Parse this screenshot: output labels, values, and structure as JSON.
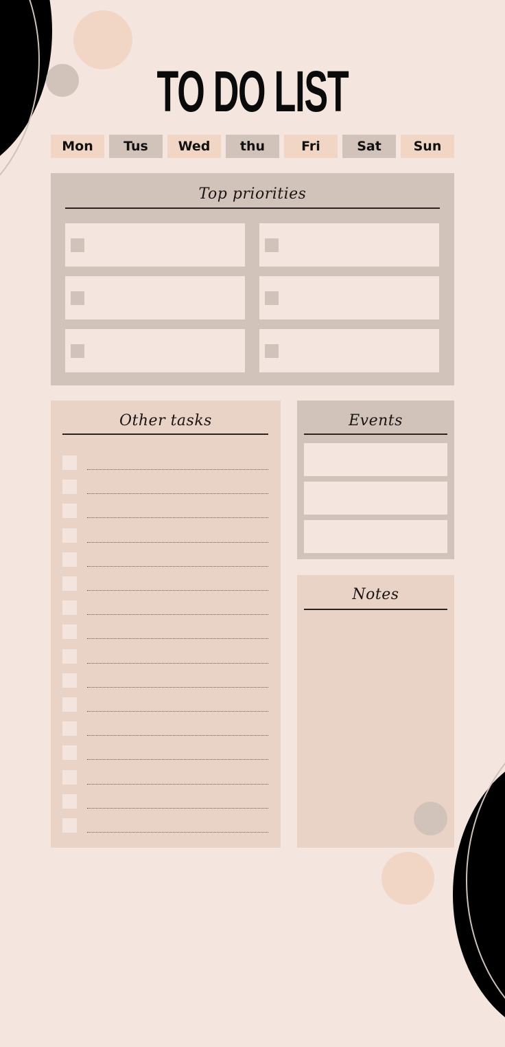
{
  "title": "TO DO LIST",
  "days": [
    "Mon",
    "Tus",
    "Wed",
    "thu",
    "Fri",
    "Sat",
    "Sun"
  ],
  "top_priorities": {
    "heading": "Top priorities",
    "items": [
      {
        "checked": false,
        "text": ""
      },
      {
        "checked": false,
        "text": ""
      },
      {
        "checked": false,
        "text": ""
      },
      {
        "checked": false,
        "text": ""
      },
      {
        "checked": false,
        "text": ""
      },
      {
        "checked": false,
        "text": ""
      }
    ]
  },
  "other_tasks": {
    "heading": "Other tasks",
    "item_count": 16
  },
  "events": {
    "heading": "Events",
    "slots": [
      "",
      "",
      ""
    ]
  },
  "notes": {
    "heading": "Notes",
    "text": ""
  },
  "colors": {
    "background": "#f4e6df",
    "peach": "#f1d6c6",
    "taupe": "#d1c3ba",
    "task_panel": "#e8d3c6",
    "ink": "#0a0a0a"
  }
}
